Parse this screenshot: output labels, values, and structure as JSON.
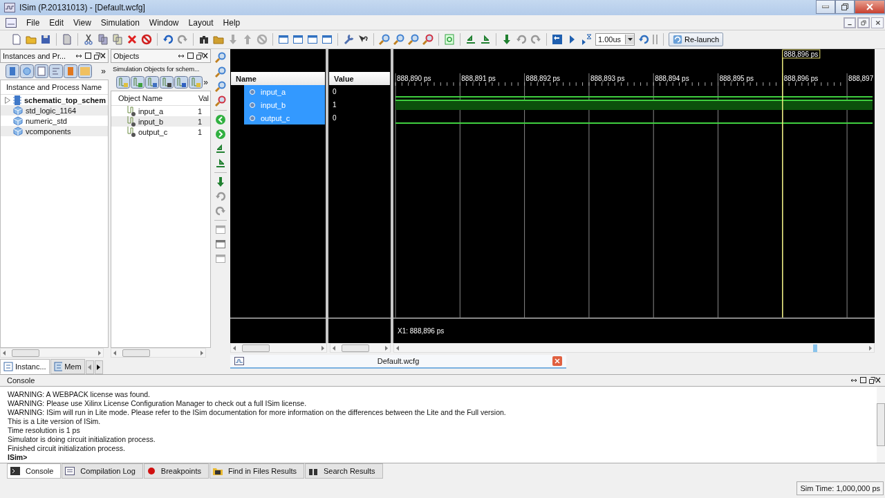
{
  "window": {
    "title": "ISim (P.20131013) - [Default.wcfg]"
  },
  "menu": [
    "File",
    "Edit",
    "View",
    "Simulation",
    "Window",
    "Layout",
    "Help"
  ],
  "toolbar": {
    "run_time": "1.00us",
    "relaunch": "Re-launch"
  },
  "instances": {
    "title": "Instances and Pr...",
    "more": "»",
    "column": "Instance and Process Name",
    "items": [
      {
        "name": "schematic_top_schem",
        "kind": "design"
      },
      {
        "name": "std_logic_1164",
        "kind": "package"
      },
      {
        "name": "numeric_std",
        "kind": "package"
      },
      {
        "name": "vcomponents",
        "kind": "package"
      }
    ],
    "tabs": [
      {
        "label": "Instanc...",
        "selected": true
      },
      {
        "label": "Mem",
        "selected": false
      }
    ]
  },
  "objects": {
    "title": "Objects",
    "subtitle": "Simulation Objects for schem...",
    "more": "»",
    "columns": [
      "Object Name",
      "Val"
    ],
    "rows": [
      {
        "name": "input_a",
        "value": "1"
      },
      {
        "name": "input_b",
        "value": "1"
      },
      {
        "name": "output_c",
        "value": "1"
      }
    ]
  },
  "wave": {
    "columns": [
      "Name",
      "Value"
    ],
    "signals": [
      {
        "name": "input_a",
        "value": "0",
        "selected": true
      },
      {
        "name": "input_b",
        "value": "1",
        "selected": true
      },
      {
        "name": "output_c",
        "value": "0",
        "selected": true
      }
    ],
    "ticks": [
      "888,890 ps",
      "888,891 ps",
      "888,892 ps",
      "888,893 ps",
      "888,894 ps",
      "888,895 ps",
      "888,896 ps",
      "888,897"
    ],
    "cursor_label": "888,896 ps",
    "cursor_readout": "X1: 888,896 ps"
  },
  "editor_tab": {
    "label": "Default.wcfg"
  },
  "console": {
    "title": "Console",
    "lines": [
      "WARNING: A WEBPACK license was found.",
      "WARNING: Please use Xilinx License Configuration Manager to check out a full ISim license.",
      "WARNING: ISim will run in Lite mode. Please refer to the ISim documentation for more information on the differences between the Lite and the Full version.",
      "This is a Lite version of ISim.",
      "Time resolution is 1 ps",
      "Simulator is doing circuit initialization process.",
      "Finished circuit initialization process."
    ],
    "prompt": "ISim>",
    "tabs": [
      {
        "label": "Console",
        "selected": true
      },
      {
        "label": "Compilation Log",
        "selected": false
      },
      {
        "label": "Breakpoints",
        "selected": false
      },
      {
        "label": "Find in Files Results",
        "selected": false
      },
      {
        "label": "Search Results",
        "selected": false
      }
    ]
  },
  "status": {
    "sim_time": "Sim Time: 1,000,000 ps"
  }
}
